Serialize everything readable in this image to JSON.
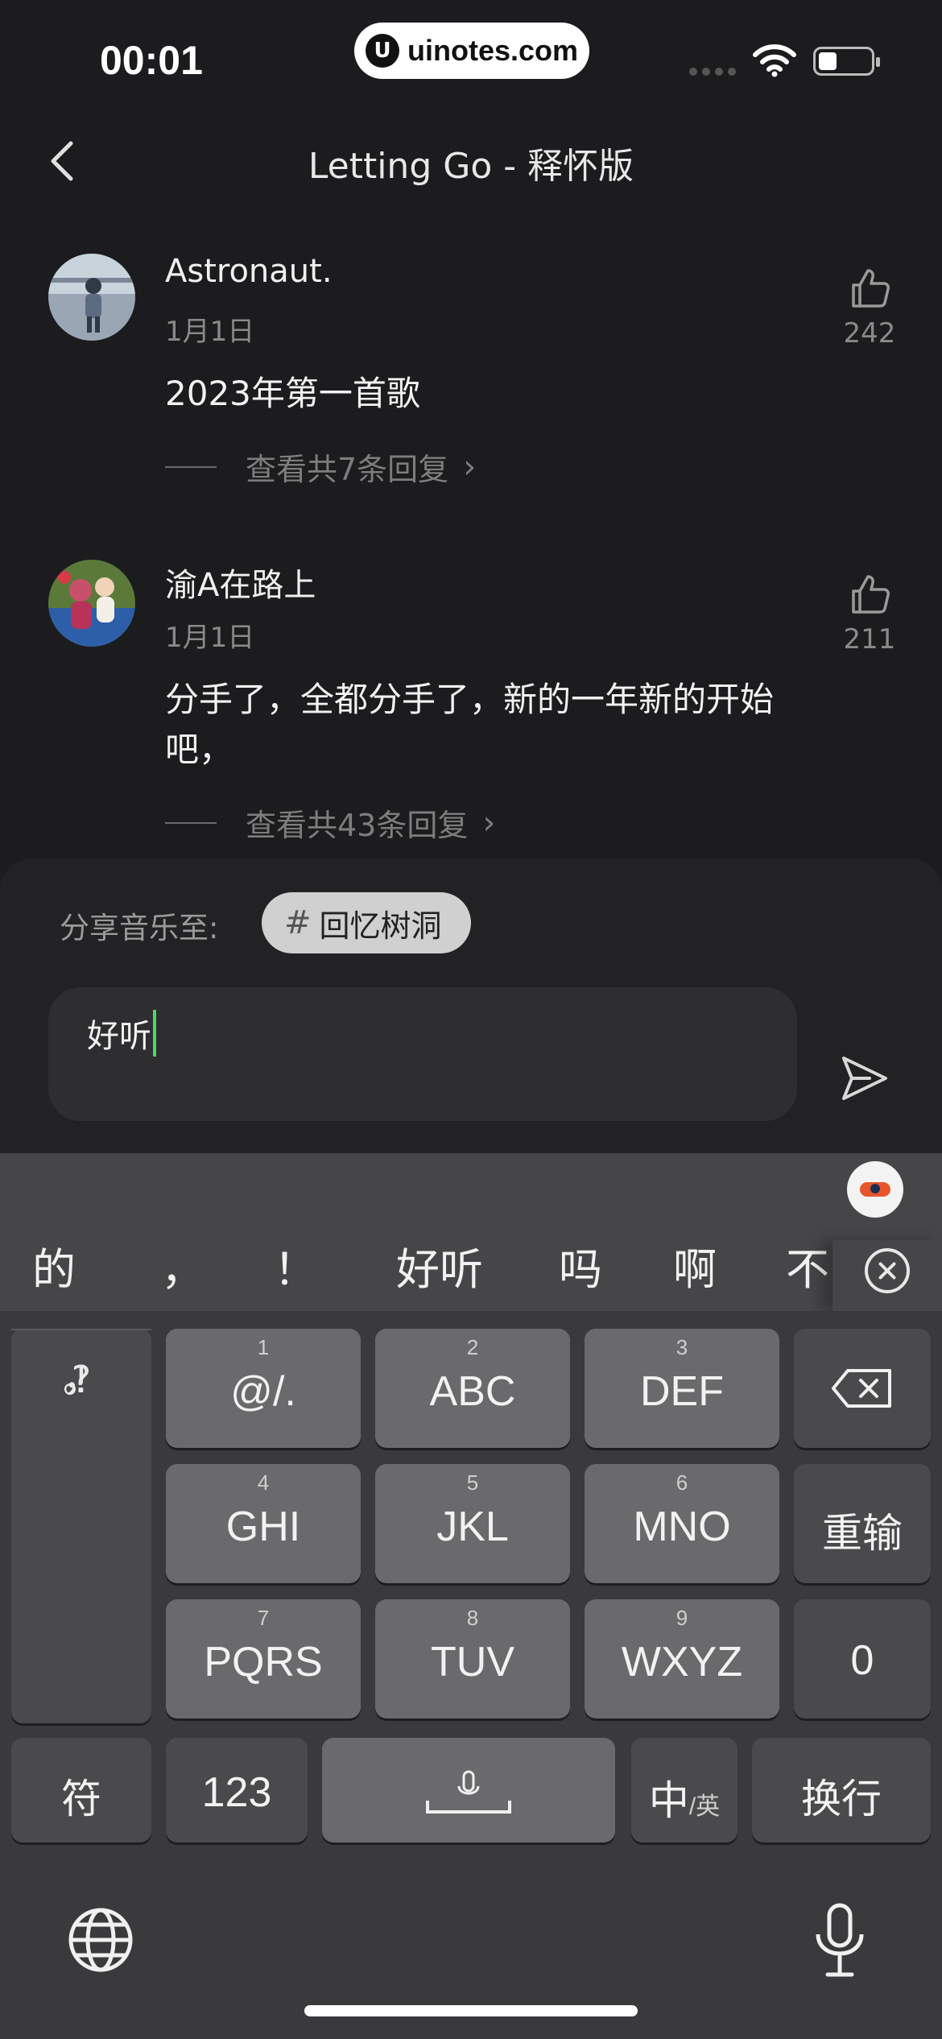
{
  "status_bar": {
    "time": "00:01",
    "watermark": "uinotes.com",
    "watermark_logo": "U"
  },
  "nav": {
    "title": "Letting Go - 释怀版",
    "back_icon": "chevron-left-icon"
  },
  "comments": [
    {
      "name": "Astronaut.",
      "date": "1月1日",
      "text": "2023年第一首歌",
      "replies": "查看共7条回复",
      "likes": "242"
    },
    {
      "name": "渝A在路上",
      "date": "1月1日",
      "text": "分手了，全都分手了，新的一年新的开始吧，",
      "replies": "查看共43条回复",
      "likes": "211"
    }
  ],
  "composer": {
    "share_label": "分享音乐至:",
    "tag_hash": "#",
    "tag": "回忆树洞",
    "input_value": "好听",
    "send_icon": "send-icon"
  },
  "keyboard": {
    "candidates": [
      "的",
      "，",
      "！",
      "好听",
      "吗",
      "啊",
      "不"
    ],
    "punctuation": [
      "，",
      "。",
      "?",
      "!"
    ],
    "rows": [
      [
        {
          "num": "1",
          "label": "@/."
        },
        {
          "num": "2",
          "label": "ABC"
        },
        {
          "num": "3",
          "label": "DEF"
        }
      ],
      [
        {
          "num": "4",
          "label": "GHI"
        },
        {
          "num": "5",
          "label": "JKL"
        },
        {
          "num": "6",
          "label": "MNO"
        }
      ],
      [
        {
          "num": "7",
          "label": "PQRS"
        },
        {
          "num": "8",
          "label": "TUV"
        },
        {
          "num": "9",
          "label": "WXYZ"
        }
      ]
    ],
    "retype": "重输",
    "zero": "0",
    "symbols": "符",
    "numbers": "123",
    "lang_main": "中",
    "lang_sub": "/英",
    "enter": "换行"
  },
  "colors": {
    "caret": "#4cd964",
    "background": "#1c1c1e",
    "keyboard": "#3a3a3c",
    "key": "#6a6a6c"
  }
}
